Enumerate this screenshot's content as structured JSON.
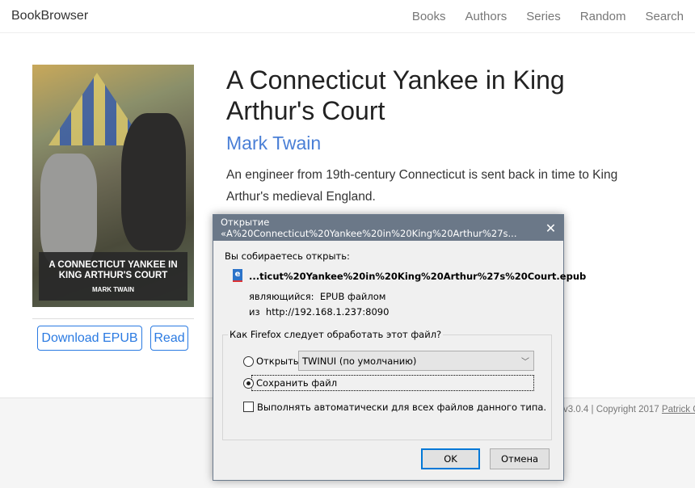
{
  "nav": {
    "brand": "BookBrowser",
    "links": [
      "Books",
      "Authors",
      "Series",
      "Random",
      "Search"
    ]
  },
  "book": {
    "title": "A Connecticut Yankee in King Arthur's Court",
    "author": "Mark Twain",
    "description": "An engineer from 19th-century Connecticut is sent back in time to King Arthur's medieval England.",
    "cover_title": "A CONNECTICUT YANKEE IN KING ARTHUR'S COURT",
    "cover_author": "MARK TWAIN",
    "download_label": "Download EPUB",
    "read_label": "Read"
  },
  "footer": {
    "text": "v3.0.4 | Copyright 2017 ",
    "link": "Patrick G"
  },
  "dialog": {
    "title": "Открытие «A%20Connecticut%20Yankee%20in%20King%20Arthur%27s...",
    "close": "✕",
    "ask": "Вы собираетесь открыть:",
    "filename": "...ticut%20Yankee%20in%20King%20Arthur%27s%20Court.epub",
    "kind_label": "являющийся:",
    "kind": "EPUB файлом",
    "from_label": "из",
    "from": "http://192.168.1.237:8090",
    "group_label": "Как Firefox следует обработать этот файл?",
    "open_with_label": "Открыть в",
    "open_with_value": "TWINUI (по умолчанию)",
    "save_label": "Сохранить файл",
    "auto_label": "Выполнять автоматически для всех файлов данного типа.",
    "ok": "OK",
    "cancel": "Отмена",
    "selected_action": "save"
  }
}
